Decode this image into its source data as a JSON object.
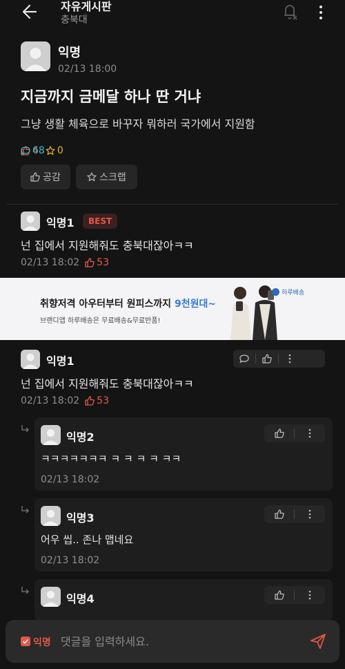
{
  "header": {
    "title": "자유게시판",
    "subtitle": "충북대",
    "back_icon": "arrow-left-icon",
    "bell_icon": "bell-off-icon",
    "more_icon": "more-vertical-icon"
  },
  "post": {
    "author": "익명",
    "time": "02/13 18:00",
    "title": "지금까지 금메달 하나 딴 거냐",
    "body": "그냥 생활 체육으로 바꾸자 뭐하러 국가에서 지원함",
    "likes": "4",
    "comments": "68",
    "scraps": "0",
    "like_button": "공감",
    "scrap_button": "스크랩"
  },
  "best_comment": {
    "author": "익명1",
    "badge": "BEST",
    "text": "넌 집에서 지원해줘도 충북대잖아ㅋㅋ",
    "time": "02/13 18:02",
    "likes": "53"
  },
  "ad": {
    "headline_prefix": "취향저격 아우터부터 원피스까지 ",
    "headline_highlight": "9천원대~",
    "subline": "브랜디앱 하루배송은 무료배송&무료반품!",
    "brand": "하루배송"
  },
  "comments": [
    {
      "author": "익명1",
      "text": "넌 집에서 지원해줘도 충북대잖아ㅋㅋ",
      "time": "02/13 18:02",
      "likes": "53"
    }
  ],
  "replies": [
    {
      "author": "익명2",
      "text": "ㅋㅋㅋㅋㅋㅋㅋ ㅋ ㅋ ㅋ ㅋ ㅋㅋ",
      "time": "02/13 18:02"
    },
    {
      "author": "익명3",
      "text": "어우 씹.. 존나 맵네요",
      "time": "02/13 18:02"
    },
    {
      "author": "익명4",
      "text": "",
      "time": ""
    }
  ],
  "composer": {
    "anon_label": "익명",
    "placeholder": "댓글을 입력하세요.",
    "send_icon": "send-icon"
  },
  "colors": {
    "background": "#141414",
    "accent_red": "#e0584a",
    "comment_teal": "#3fb6c8",
    "scrap_yellow": "#e9b82f"
  }
}
